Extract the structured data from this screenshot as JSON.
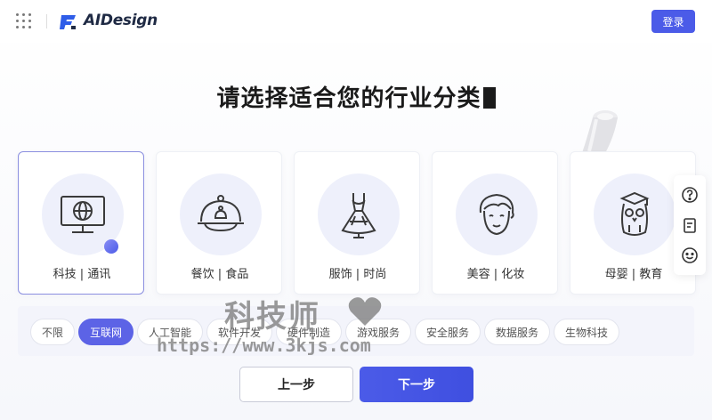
{
  "header": {
    "brand": "AIDesign",
    "login_label": "登录"
  },
  "title": "请选择适合您的行业分类",
  "categories": [
    {
      "label": "科技 | 通讯",
      "icon": "monitor-globe-icon",
      "selected": true
    },
    {
      "label": "餐饮 | 食品",
      "icon": "cloche-food-icon",
      "selected": false
    },
    {
      "label": "服饰 | 时尚",
      "icon": "dress-icon",
      "selected": false
    },
    {
      "label": "美容 | 化妆",
      "icon": "face-icon",
      "selected": false
    },
    {
      "label": "母婴 | 教育",
      "icon": "owl-graduate-icon",
      "selected": false
    }
  ],
  "subcategories": [
    {
      "label": "不限",
      "selected": false
    },
    {
      "label": "互联网",
      "selected": true
    },
    {
      "label": "人工智能",
      "selected": false
    },
    {
      "label": "软件开发",
      "selected": false
    },
    {
      "label": "硬件制造",
      "selected": false
    },
    {
      "label": "游戏服务",
      "selected": false
    },
    {
      "label": "安全服务",
      "selected": false
    },
    {
      "label": "数据服务",
      "selected": false
    },
    {
      "label": "生物科技",
      "selected": false
    }
  ],
  "watermark": {
    "title": "科技师",
    "url": "https://www.3kjs.com"
  },
  "buttons": {
    "prev": "上一步",
    "next": "下一步"
  },
  "colors": {
    "accent": "#4b5be8",
    "tag_active": "#5c63e6"
  }
}
